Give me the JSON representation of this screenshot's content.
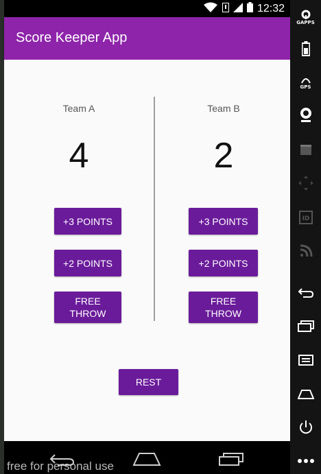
{
  "status_bar": {
    "time": "12:32"
  },
  "app_bar": {
    "title": "Score Keeper App"
  },
  "team_a": {
    "name": "Team A",
    "score": "4",
    "buttons": {
      "plus3": "+3 POINTS",
      "plus2": "+2 POINTS",
      "free_throw": "FREE\nTHROW"
    }
  },
  "team_b": {
    "name": "Team B",
    "score": "2",
    "buttons": {
      "plus3": "+3 POINTS",
      "plus2": "+2 POINTS",
      "free_throw": "FREE\nTHROW"
    }
  },
  "reset_label": "REST",
  "watermark": "free for personal use",
  "emulator_panel": {
    "tools": [
      {
        "icon": "gapps-icon",
        "label": "GAPPS"
      },
      {
        "icon": "battery-icon",
        "label": ""
      },
      {
        "icon": "gps-icon",
        "label": "GPS"
      },
      {
        "icon": "camera-icon",
        "label": ""
      },
      {
        "icon": "media-icon",
        "label": ""
      },
      {
        "icon": "dpad-icon",
        "label": ""
      },
      {
        "icon": "id-icon",
        "label": "ID"
      },
      {
        "icon": "rss-icon",
        "label": ""
      },
      {
        "icon": "back-icon",
        "label": ""
      },
      {
        "icon": "recent-apps-icon",
        "label": ""
      },
      {
        "icon": "menu-icon",
        "label": ""
      },
      {
        "icon": "home-icon",
        "label": ""
      },
      {
        "icon": "power-icon",
        "label": ""
      },
      {
        "icon": "more-icon",
        "label": ""
      }
    ]
  },
  "colors": {
    "app_bar": "#8e24aa",
    "button": "#6a1b9a",
    "background": "#fafafa"
  }
}
